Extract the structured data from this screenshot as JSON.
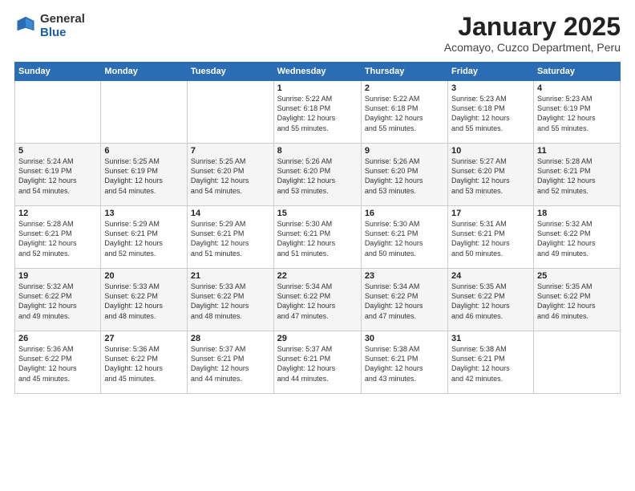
{
  "logo": {
    "general": "General",
    "blue": "Blue"
  },
  "header": {
    "title": "January 2025",
    "subtitle": "Acomayo, Cuzco Department, Peru"
  },
  "weekdays": [
    "Sunday",
    "Monday",
    "Tuesday",
    "Wednesday",
    "Thursday",
    "Friday",
    "Saturday"
  ],
  "weeks": [
    [
      {
        "day": "",
        "info": ""
      },
      {
        "day": "",
        "info": ""
      },
      {
        "day": "",
        "info": ""
      },
      {
        "day": "1",
        "info": "Sunrise: 5:22 AM\nSunset: 6:18 PM\nDaylight: 12 hours\nand 55 minutes."
      },
      {
        "day": "2",
        "info": "Sunrise: 5:22 AM\nSunset: 6:18 PM\nDaylight: 12 hours\nand 55 minutes."
      },
      {
        "day": "3",
        "info": "Sunrise: 5:23 AM\nSunset: 6:18 PM\nDaylight: 12 hours\nand 55 minutes."
      },
      {
        "day": "4",
        "info": "Sunrise: 5:23 AM\nSunset: 6:19 PM\nDaylight: 12 hours\nand 55 minutes."
      }
    ],
    [
      {
        "day": "5",
        "info": "Sunrise: 5:24 AM\nSunset: 6:19 PM\nDaylight: 12 hours\nand 54 minutes."
      },
      {
        "day": "6",
        "info": "Sunrise: 5:25 AM\nSunset: 6:19 PM\nDaylight: 12 hours\nand 54 minutes."
      },
      {
        "day": "7",
        "info": "Sunrise: 5:25 AM\nSunset: 6:20 PM\nDaylight: 12 hours\nand 54 minutes."
      },
      {
        "day": "8",
        "info": "Sunrise: 5:26 AM\nSunset: 6:20 PM\nDaylight: 12 hours\nand 53 minutes."
      },
      {
        "day": "9",
        "info": "Sunrise: 5:26 AM\nSunset: 6:20 PM\nDaylight: 12 hours\nand 53 minutes."
      },
      {
        "day": "10",
        "info": "Sunrise: 5:27 AM\nSunset: 6:20 PM\nDaylight: 12 hours\nand 53 minutes."
      },
      {
        "day": "11",
        "info": "Sunrise: 5:28 AM\nSunset: 6:21 PM\nDaylight: 12 hours\nand 52 minutes."
      }
    ],
    [
      {
        "day": "12",
        "info": "Sunrise: 5:28 AM\nSunset: 6:21 PM\nDaylight: 12 hours\nand 52 minutes."
      },
      {
        "day": "13",
        "info": "Sunrise: 5:29 AM\nSunset: 6:21 PM\nDaylight: 12 hours\nand 52 minutes."
      },
      {
        "day": "14",
        "info": "Sunrise: 5:29 AM\nSunset: 6:21 PM\nDaylight: 12 hours\nand 51 minutes."
      },
      {
        "day": "15",
        "info": "Sunrise: 5:30 AM\nSunset: 6:21 PM\nDaylight: 12 hours\nand 51 minutes."
      },
      {
        "day": "16",
        "info": "Sunrise: 5:30 AM\nSunset: 6:21 PM\nDaylight: 12 hours\nand 50 minutes."
      },
      {
        "day": "17",
        "info": "Sunrise: 5:31 AM\nSunset: 6:21 PM\nDaylight: 12 hours\nand 50 minutes."
      },
      {
        "day": "18",
        "info": "Sunrise: 5:32 AM\nSunset: 6:22 PM\nDaylight: 12 hours\nand 49 minutes."
      }
    ],
    [
      {
        "day": "19",
        "info": "Sunrise: 5:32 AM\nSunset: 6:22 PM\nDaylight: 12 hours\nand 49 minutes."
      },
      {
        "day": "20",
        "info": "Sunrise: 5:33 AM\nSunset: 6:22 PM\nDaylight: 12 hours\nand 48 minutes."
      },
      {
        "day": "21",
        "info": "Sunrise: 5:33 AM\nSunset: 6:22 PM\nDaylight: 12 hours\nand 48 minutes."
      },
      {
        "day": "22",
        "info": "Sunrise: 5:34 AM\nSunset: 6:22 PM\nDaylight: 12 hours\nand 47 minutes."
      },
      {
        "day": "23",
        "info": "Sunrise: 5:34 AM\nSunset: 6:22 PM\nDaylight: 12 hours\nand 47 minutes."
      },
      {
        "day": "24",
        "info": "Sunrise: 5:35 AM\nSunset: 6:22 PM\nDaylight: 12 hours\nand 46 minutes."
      },
      {
        "day": "25",
        "info": "Sunrise: 5:35 AM\nSunset: 6:22 PM\nDaylight: 12 hours\nand 46 minutes."
      }
    ],
    [
      {
        "day": "26",
        "info": "Sunrise: 5:36 AM\nSunset: 6:22 PM\nDaylight: 12 hours\nand 45 minutes."
      },
      {
        "day": "27",
        "info": "Sunrise: 5:36 AM\nSunset: 6:22 PM\nDaylight: 12 hours\nand 45 minutes."
      },
      {
        "day": "28",
        "info": "Sunrise: 5:37 AM\nSunset: 6:21 PM\nDaylight: 12 hours\nand 44 minutes."
      },
      {
        "day": "29",
        "info": "Sunrise: 5:37 AM\nSunset: 6:21 PM\nDaylight: 12 hours\nand 44 minutes."
      },
      {
        "day": "30",
        "info": "Sunrise: 5:38 AM\nSunset: 6:21 PM\nDaylight: 12 hours\nand 43 minutes."
      },
      {
        "day": "31",
        "info": "Sunrise: 5:38 AM\nSunset: 6:21 PM\nDaylight: 12 hours\nand 42 minutes."
      },
      {
        "day": "",
        "info": ""
      }
    ]
  ]
}
